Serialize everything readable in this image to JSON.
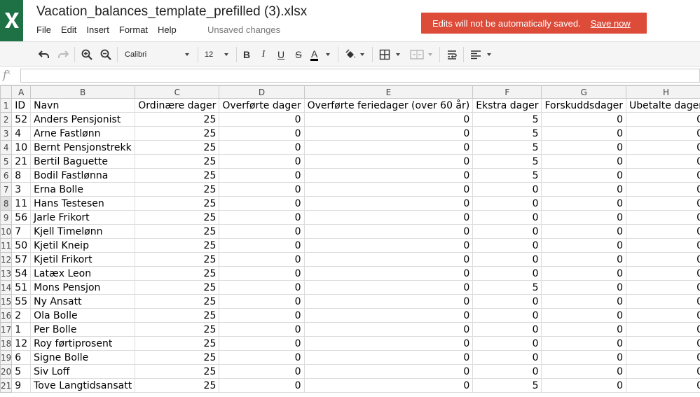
{
  "header": {
    "title": "Vacation_balances_template_prefilled (3).xlsx",
    "menu": [
      "File",
      "Edit",
      "Insert",
      "Format",
      "Help"
    ],
    "status": "Unsaved changes",
    "banner": {
      "message": "Edits will not be automatically saved.",
      "action": "Save now",
      "color": "#dd4b39"
    },
    "brand_color": "#1e7145"
  },
  "toolbar": {
    "font_name": "Calibri",
    "font_size": "12",
    "bold": "B",
    "italic": "I",
    "underline": "U",
    "strike": "S",
    "text_color_letter": "A",
    "text_color": "#000000",
    "icons": [
      "undo-icon",
      "redo-icon",
      "zoom-in-icon",
      "zoom-out-icon",
      "fill-color-icon",
      "borders-icon",
      "merge-cells-icon",
      "wrap-text-icon",
      "align-icon"
    ]
  },
  "formula_bar": {
    "label": "f",
    "label_sup": "x",
    "value": ""
  },
  "sheet": {
    "columns": [
      "A",
      "B",
      "C",
      "D",
      "E",
      "F",
      "G",
      "H"
    ],
    "header_row": {
      "num": "1",
      "cells": [
        "ID",
        "Navn",
        "Ordinære dager",
        "Overførte dager",
        "Overførte feriedager (over 60 år)",
        "Ekstra dager",
        "Forskuddsdager",
        "Ubetalte dager"
      ]
    },
    "active_row": 8,
    "rows": [
      {
        "num": "2",
        "cells": [
          "52",
          "Anders Pensjonist",
          "25",
          "0",
          "0",
          "5",
          "0",
          "0"
        ]
      },
      {
        "num": "3",
        "cells": [
          "4",
          "Arne Fastlønn",
          "25",
          "0",
          "0",
          "5",
          "0",
          "0"
        ]
      },
      {
        "num": "4",
        "cells": [
          "10",
          "Bernt Pensjonstrekk",
          "25",
          "0",
          "0",
          "5",
          "0",
          "0"
        ]
      },
      {
        "num": "5",
        "cells": [
          "21",
          "Bertil Baguette",
          "25",
          "0",
          "0",
          "5",
          "0",
          "0"
        ]
      },
      {
        "num": "6",
        "cells": [
          "8",
          "Bodil Fastlønna",
          "25",
          "0",
          "0",
          "5",
          "0",
          "0"
        ]
      },
      {
        "num": "7",
        "cells": [
          "3",
          "Erna Bolle",
          "25",
          "0",
          "0",
          "0",
          "0",
          "0"
        ]
      },
      {
        "num": "8",
        "cells": [
          "11",
          "Hans Testesen",
          "25",
          "0",
          "0",
          "0",
          "0",
          "0"
        ]
      },
      {
        "num": "9",
        "cells": [
          "56",
          "Jarle Frikort",
          "25",
          "0",
          "0",
          "0",
          "0",
          "0"
        ]
      },
      {
        "num": "10",
        "cells": [
          "7",
          "Kjell Timelønn",
          "25",
          "0",
          "0",
          "0",
          "0",
          "0"
        ]
      },
      {
        "num": "11",
        "cells": [
          "50",
          "Kjetil Kneip",
          "25",
          "0",
          "0",
          "0",
          "0",
          "0"
        ]
      },
      {
        "num": "12",
        "cells": [
          "57",
          "Kjetil Frikort",
          "25",
          "0",
          "0",
          "0",
          "0",
          "0"
        ]
      },
      {
        "num": "13",
        "cells": [
          "54",
          "Latæx Leon",
          "25",
          "0",
          "0",
          "0",
          "0",
          "0"
        ]
      },
      {
        "num": "14",
        "cells": [
          "51",
          "Mons Pensjon",
          "25",
          "0",
          "0",
          "5",
          "0",
          "0"
        ]
      },
      {
        "num": "15",
        "cells": [
          "55",
          "Ny Ansatt",
          "25",
          "0",
          "0",
          "0",
          "0",
          "0"
        ]
      },
      {
        "num": "16",
        "cells": [
          "2",
          "Ola Bolle",
          "25",
          "0",
          "0",
          "0",
          "0",
          "0"
        ]
      },
      {
        "num": "17",
        "cells": [
          "1",
          "Per Bolle",
          "25",
          "0",
          "0",
          "0",
          "0",
          "0"
        ]
      },
      {
        "num": "18",
        "cells": [
          "12",
          "Roy førtiprosent",
          "25",
          "0",
          "0",
          "0",
          "0",
          "0"
        ]
      },
      {
        "num": "19",
        "cells": [
          "6",
          "Signe Bolle",
          "25",
          "0",
          "0",
          "0",
          "0",
          "0"
        ]
      },
      {
        "num": "20",
        "cells": [
          "5",
          "Siv Loff",
          "25",
          "0",
          "0",
          "0",
          "0",
          "0"
        ]
      },
      {
        "num": "21",
        "cells": [
          "9",
          "Tove Langtidsansatt",
          "25",
          "0",
          "0",
          "5",
          "0",
          "0"
        ]
      }
    ]
  }
}
